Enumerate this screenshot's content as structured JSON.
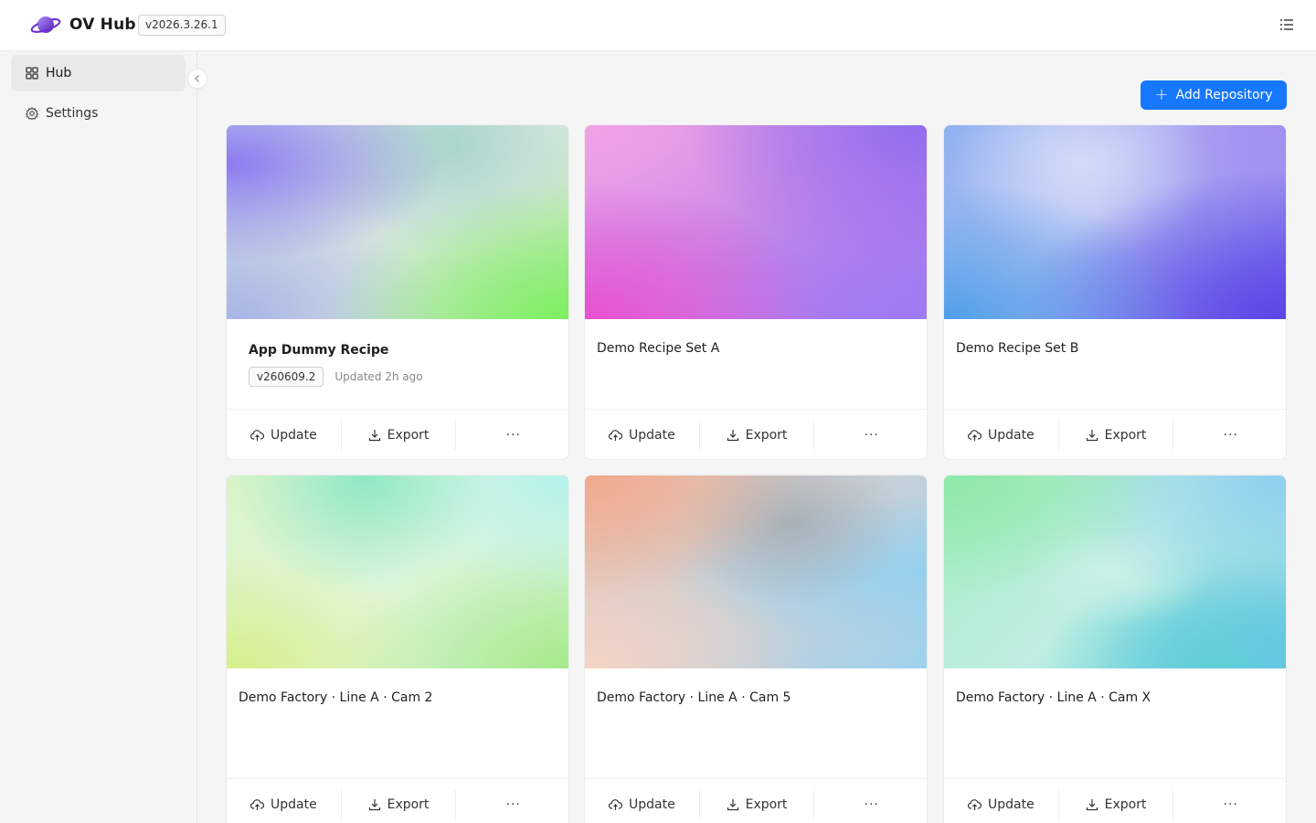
{
  "header": {
    "app_title": "OV Hub",
    "version": "v2026.3.26.1",
    "menu_icon": "list-icon",
    "brand_color": "#7c3aed"
  },
  "sidebar": {
    "items": [
      {
        "label": "Hub",
        "icon": "grid-icon",
        "active": true
      },
      {
        "label": "Settings",
        "icon": "gear-icon",
        "active": false
      }
    ]
  },
  "main": {
    "add_repository_label": "Add Repository",
    "accent_color": "#1677ff",
    "cards": [
      {
        "title": "App Dummy Recipe",
        "tag": "v260609.2",
        "updated": "Updated 2h ago",
        "update_label": "Update",
        "export_label": "Export",
        "more_label": "···"
      },
      {
        "title": "Demo Recipe Set A",
        "update_label": "Update",
        "export_label": "Export",
        "more_label": "···"
      },
      {
        "title": "Demo Recipe Set B",
        "update_label": "Update",
        "export_label": "Export",
        "more_label": "···"
      },
      {
        "title": "Demo Factory · Line A · Cam 2",
        "update_label": "Update",
        "export_label": "Export",
        "more_label": "···"
      },
      {
        "title": "Demo Factory · Line A · Cam 5",
        "update_label": "Update",
        "export_label": "Export",
        "more_label": "···"
      },
      {
        "title": "Demo Factory · Line A · Cam X",
        "update_label": "Update",
        "export_label": "Export",
        "more_label": "···"
      }
    ]
  }
}
